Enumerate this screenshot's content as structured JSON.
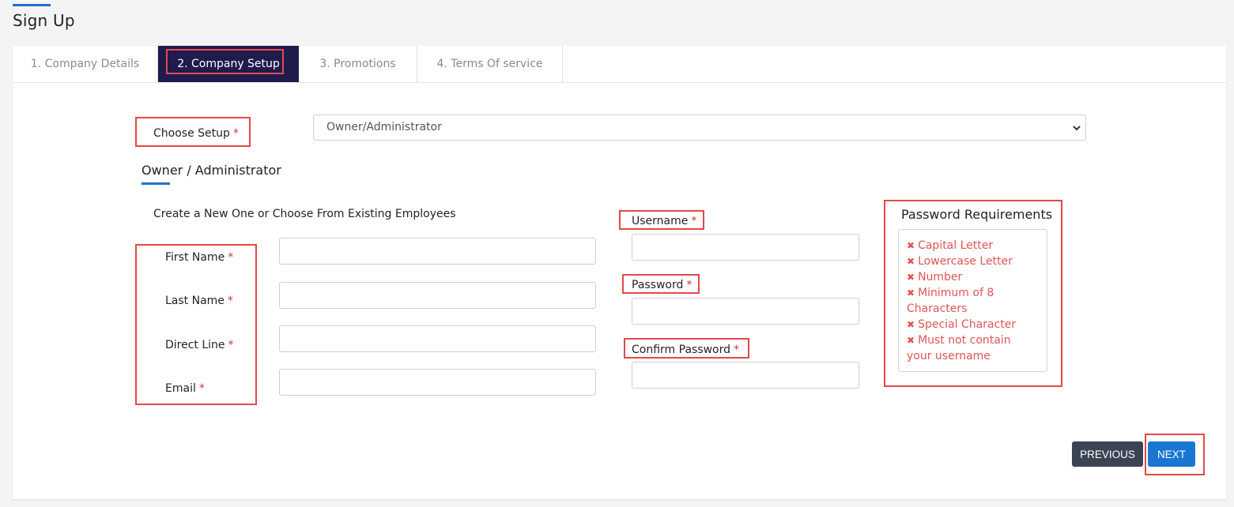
{
  "page": {
    "title": "Sign Up"
  },
  "tabs": [
    {
      "label": "1.  Company Details"
    },
    {
      "label": "2.  Company Setup",
      "active": true
    },
    {
      "label": "3.  Promotions"
    },
    {
      "label": "4.  Terms Of service"
    }
  ],
  "setup": {
    "label": "Choose Setup",
    "required_marker": "*",
    "selected": "Owner/Administrator"
  },
  "section": {
    "title": "Owner / Administrator"
  },
  "employees_hint": "Create a New One or Choose From Existing Employees",
  "fields": {
    "first_name": {
      "label": "First Name",
      "value": ""
    },
    "last_name": {
      "label": "Last Name",
      "value": ""
    },
    "direct_line": {
      "label": "Direct Line",
      "value": ""
    },
    "email": {
      "label": "Email",
      "value": ""
    },
    "username": {
      "label": "Username",
      "value": ""
    },
    "password": {
      "label": "Password",
      "value": ""
    },
    "confirm_password": {
      "label": "Confirm Password",
      "value": ""
    }
  },
  "password_requirements": {
    "title": "Password Requirements",
    "items": [
      "Capital Letter",
      "Lowercase Letter",
      "Number",
      "Minimum of 8 Characters",
      "Special Character",
      "Must not contain your username"
    ]
  },
  "buttons": {
    "previous": "PREVIOUS",
    "next": "NEXT"
  },
  "colors": {
    "accent": "#1976d2",
    "active_tab": "#1f1b4d",
    "error": "#e05555",
    "highlight": "#e54848"
  }
}
